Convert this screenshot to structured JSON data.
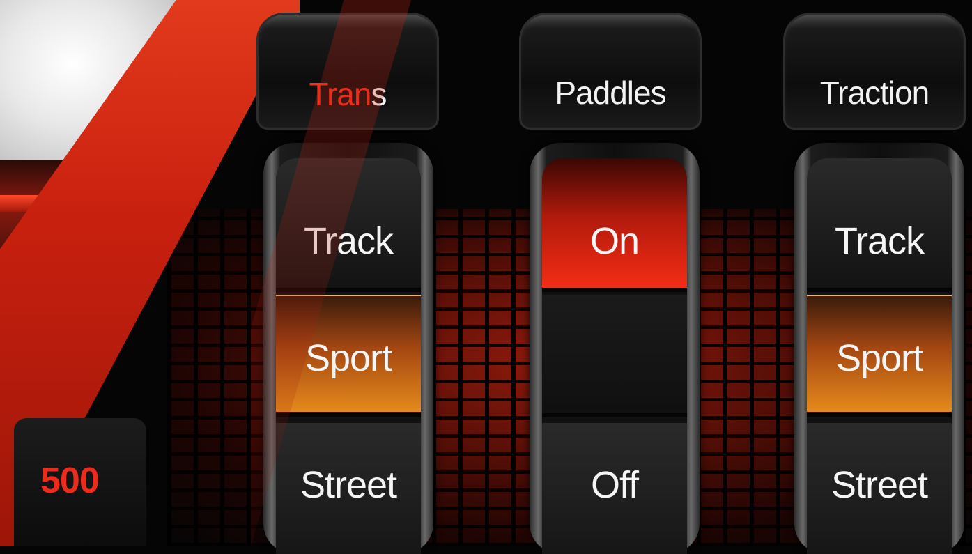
{
  "odometer": {
    "value": "500"
  },
  "columns": [
    {
      "title_hi": "Tran",
      "title_rest": "s",
      "options": {
        "top": "Track",
        "mid": "Sport",
        "bot": "Street"
      },
      "active": "mid"
    },
    {
      "title_hi": "",
      "title_rest": "Paddles",
      "options": {
        "top": "On",
        "mid": "",
        "bot": "Off"
      },
      "active": "top"
    },
    {
      "title_hi": "",
      "title_rest": "Traction",
      "options": {
        "top": "Track",
        "mid": "Sport",
        "bot": "Street"
      },
      "active": "mid"
    }
  ],
  "colors": {
    "accent_red": "#f2321d",
    "active_orange": "#e58a1c",
    "active_red": "#f42d15"
  }
}
